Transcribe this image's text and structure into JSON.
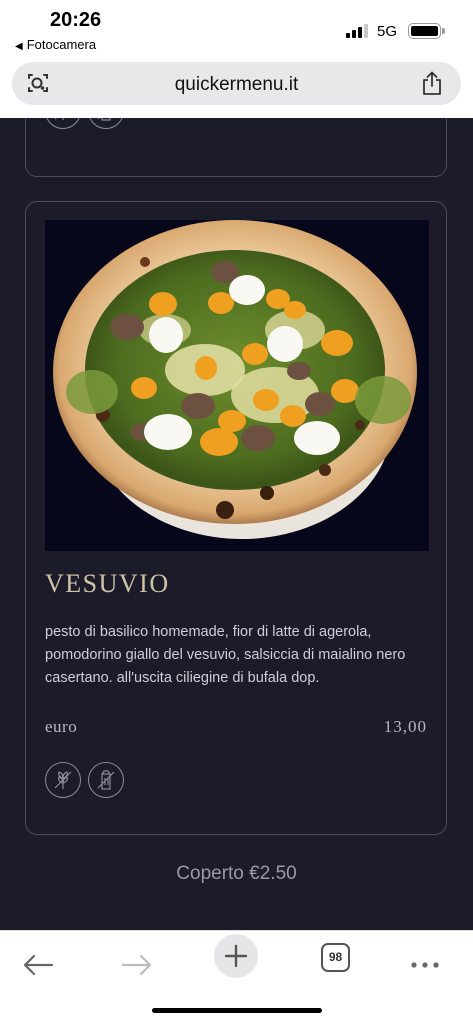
{
  "status_bar": {
    "time": "20:26",
    "back_app": "Fotocamera",
    "network": "5G"
  },
  "browser": {
    "url": "quickermenu.it",
    "tab_count": "98"
  },
  "menu_item": {
    "title": "VESUVIO",
    "description": "pesto di basilico homemade, fior di latte di agerola, pomodorino giallo del vesuvio, salsiccia di maialino nero casertano. all'uscita ciliegine di bufala dop.",
    "price_label": "euro",
    "price_value": "13,00",
    "icons": [
      "gluten-icon",
      "lactose-icon"
    ]
  },
  "footer": {
    "coperto": "Coperto €2.50"
  },
  "colors": {
    "background": "#1b1b29",
    "title": "#cfc3a6",
    "card_border": "#4c4c5a"
  }
}
